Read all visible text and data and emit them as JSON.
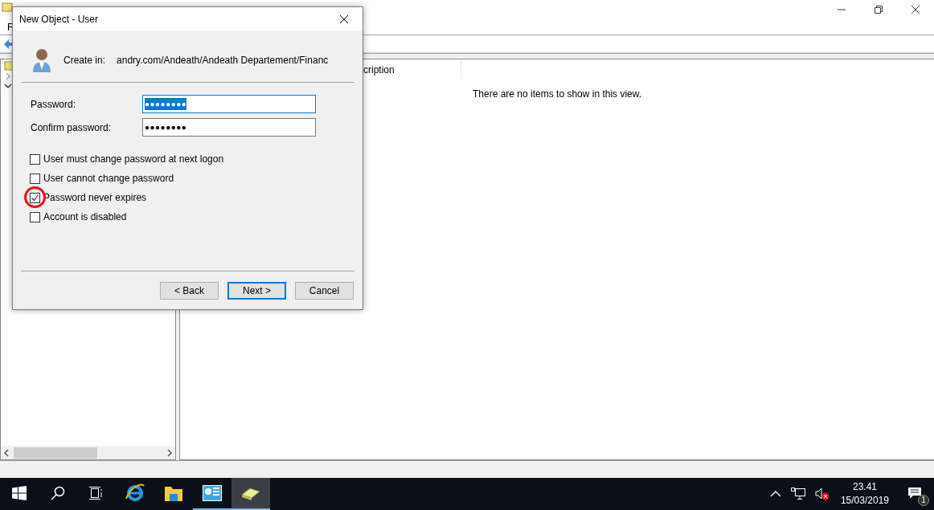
{
  "main_window": {
    "menu": [
      "F"
    ],
    "list_columns": [
      "cription"
    ],
    "empty_message": "There are no items to show in this view.",
    "tree_nodes": [
      {
        "expanded": false
      },
      {
        "expanded": true
      }
    ]
  },
  "dialog": {
    "title": "New Object - User",
    "create_in_label": "Create in:",
    "create_in_path": "andry.com/Andeath/Andeath Departement/Financ",
    "fields": [
      {
        "label": "Password:",
        "value": "●●●●●●●●",
        "focused": true
      },
      {
        "label": "Confirm password:",
        "value": "●●●●●●●●",
        "focused": false
      }
    ],
    "options": [
      {
        "label": "User must change password at next logon",
        "checked": false,
        "circled": false
      },
      {
        "label": "User cannot change password",
        "checked": false,
        "circled": false
      },
      {
        "label": "Password never expires",
        "checked": true,
        "circled": true
      },
      {
        "label": "Account is disabled",
        "checked": false,
        "circled": false
      }
    ],
    "buttons": [
      {
        "label": "< Back",
        "default": false
      },
      {
        "label": "Next >",
        "default": true
      },
      {
        "label": "Cancel",
        "default": false
      }
    ]
  },
  "taskbar": {
    "apps": [
      {
        "kind": "browser",
        "running": false,
        "selected": false
      },
      {
        "kind": "folder",
        "running": false,
        "selected": false
      },
      {
        "kind": "dashboard",
        "running": true,
        "selected": false
      },
      {
        "kind": "directory",
        "running": true,
        "selected": true
      }
    ],
    "clock": {
      "time": "23.41",
      "date": "15/03/2019"
    },
    "notification_count": "1"
  }
}
